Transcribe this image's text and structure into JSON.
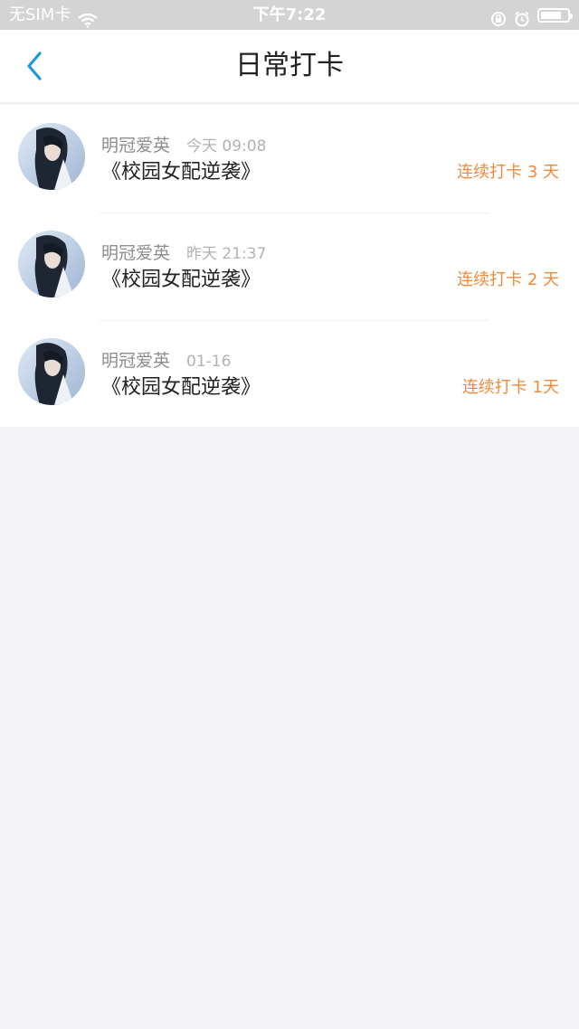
{
  "status_bar": {
    "carrier": "无SIM卡",
    "time": "下午7:22"
  },
  "nav": {
    "title": "日常打卡",
    "back_icon": "chevron-left-icon"
  },
  "colors": {
    "accent_blue": "#1a9bdb",
    "streak_orange": "#f08a3a"
  },
  "checkins": [
    {
      "name": "明冠爱英",
      "time": "今天 09:08",
      "book": "《校园女配逆袭》",
      "streak": "连续打卡 3 天"
    },
    {
      "name": "明冠爱英",
      "time": "昨天 21:37",
      "book": "《校园女配逆袭》",
      "streak": "连续打卡 2 天"
    },
    {
      "name": "明冠爱英",
      "time": "01-16",
      "book": "《校园女配逆袭》",
      "streak": "连续打卡 1天"
    }
  ]
}
